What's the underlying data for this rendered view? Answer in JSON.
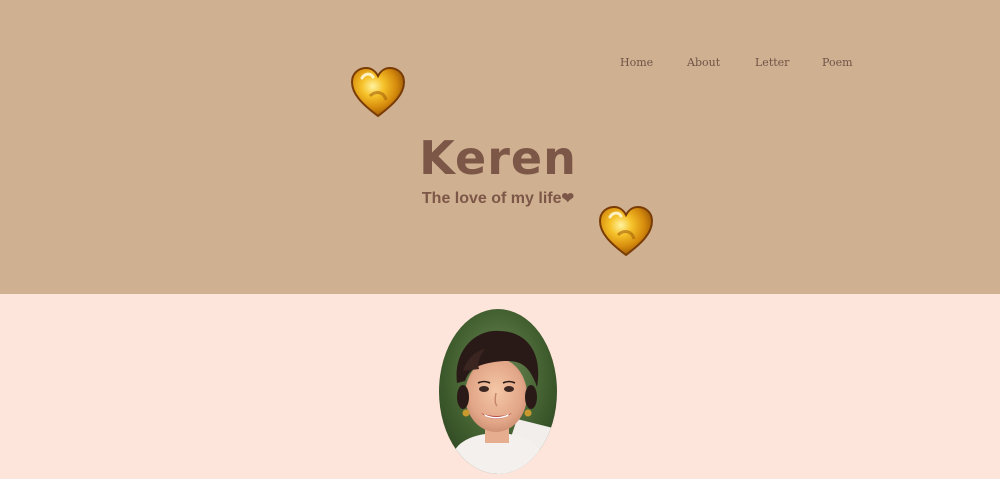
{
  "nav": {
    "items": [
      {
        "label": "Home"
      },
      {
        "label": "About"
      },
      {
        "label": "Letter"
      },
      {
        "label": "Poem"
      }
    ]
  },
  "hero": {
    "title": "Keren",
    "subtitle": "The love of my life",
    "subtitle_glyph": "❤"
  },
  "colors": {
    "header_bg": "#cfb091",
    "content_bg": "#fee5db",
    "text": "#7c5748",
    "nav_text": "#6f5447",
    "heart_gold": "#e0a018"
  },
  "icons": {
    "decorative": [
      "gold-heart-icon",
      "gold-heart-icon"
    ]
  }
}
